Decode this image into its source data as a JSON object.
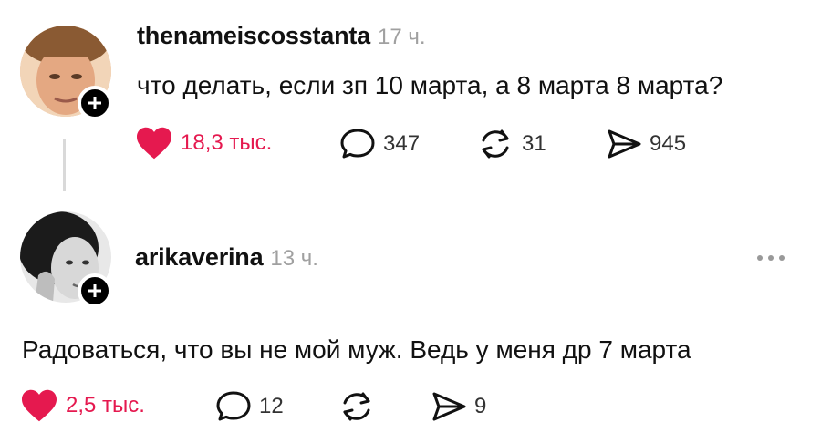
{
  "posts": [
    {
      "username": "thenameiscosstanta",
      "time": "17 ч.",
      "text": "что делать, если зп 10 марта, а 8 марта 8 марта?",
      "likes": "18,3 тыс.",
      "comments": "347",
      "reposts": "31",
      "shares": "945"
    },
    {
      "username": "arikaverina",
      "time": "13 ч.",
      "text": "Радоваться, что вы не мой муж. Ведь у меня др 7 марта",
      "likes": "2,5 тыс.",
      "comments": "12",
      "reposts": "",
      "shares": "9"
    }
  ],
  "colors": {
    "like": "#e5194f",
    "text": "#111111",
    "muted": "#a0a0a0"
  },
  "icons": [
    "heart-icon",
    "comment-icon",
    "repost-icon",
    "share-icon",
    "plus-icon",
    "more-icon"
  ]
}
